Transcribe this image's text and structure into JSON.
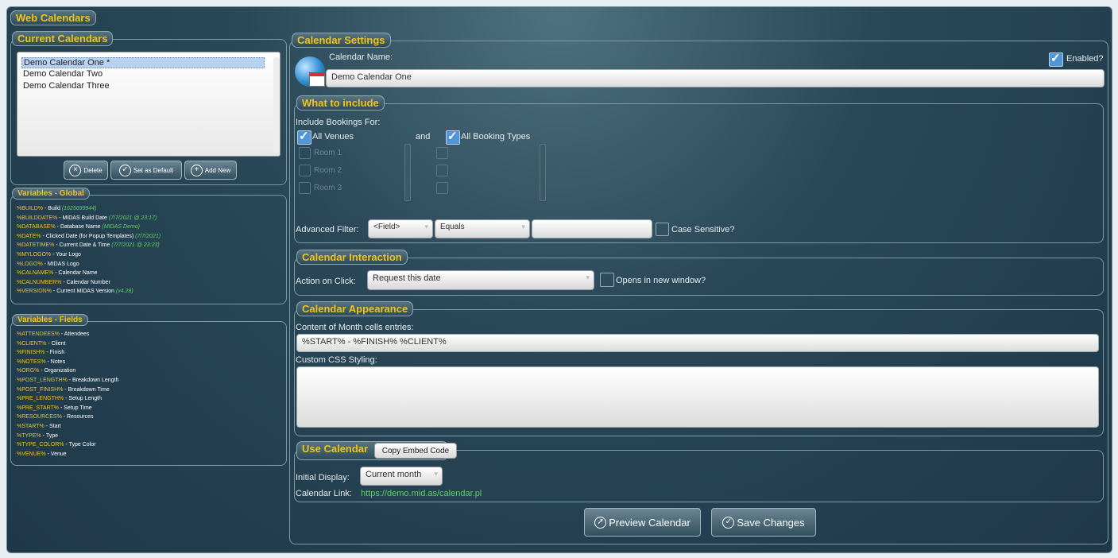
{
  "window_title": "Web Calendars",
  "current_calendars": {
    "title": "Current Calendars",
    "items": [
      "Demo Calendar One *",
      "Demo Calendar Two",
      "Demo Calendar Three"
    ],
    "delete": "Delete",
    "set_default": "Set as Default",
    "add_new": "Add New"
  },
  "vars_global": {
    "title": "Variables - Global",
    "rows": [
      {
        "k": "%BUILD%",
        "d": " - Build ",
        "g": "(1625699944)"
      },
      {
        "k": "%BUILDDATE%",
        "d": " - MIDAS Build Date ",
        "g": "(7/7/2021 @ 23:17)"
      },
      {
        "k": "%DATABASE%",
        "d": " - Database Name ",
        "g": "(MIDAS Demo)"
      },
      {
        "k": "%DATE%",
        "d": " - Clicked Date (for Popup Templates) ",
        "g": "(7/7/2021)"
      },
      {
        "k": "%DATETIME%",
        "d": " - Current Date & Time ",
        "g": "(7/7/2021 @ 23:23)"
      },
      {
        "k": "%MYLOGO%",
        "d": " - Your Logo",
        "g": ""
      },
      {
        "k": "%LOGO%",
        "d": " - MIDAS Logo",
        "g": ""
      },
      {
        "k": "%CALNAME%",
        "d": " - Calendar Name",
        "g": ""
      },
      {
        "k": "%CALNUMBER%",
        "d": " - Calendar Number",
        "g": ""
      },
      {
        "k": "%VERSION%",
        "d": " - Current MIDAS Version ",
        "g": "(v4.28)"
      }
    ]
  },
  "vars_fields": {
    "title": "Variables - Fields",
    "rows": [
      {
        "k": "%ATTENDEES%",
        "d": " - Attendees"
      },
      {
        "k": "%CLIENT%",
        "d": " - Client"
      },
      {
        "k": "%FINISH%",
        "d": " - Finish"
      },
      {
        "k": "%NOTES%",
        "d": " - Notes"
      },
      {
        "k": "%ORG%",
        "d": " - Organization"
      },
      {
        "k": "%POST_LENGTH%",
        "d": " - Breakdown Length"
      },
      {
        "k": "%POST_FINISH%",
        "d": " - Breakdown Time"
      },
      {
        "k": "%PRE_LENGTH%",
        "d": " - Setup Length"
      },
      {
        "k": "%PRE_START%",
        "d": " - Setup Time"
      },
      {
        "k": "%RESOURCES%",
        "d": " - Resources"
      },
      {
        "k": "%START%",
        "d": " - Start"
      },
      {
        "k": "%TYPE%",
        "d": " - Type"
      },
      {
        "k": "%TYPE_COLOR%",
        "d": " - Type Color"
      },
      {
        "k": "%VENUE%",
        "d": " - Venue"
      }
    ]
  },
  "settings": {
    "title": "Calendar Settings",
    "name_label": "Calendar Name:",
    "name_value": "Demo Calendar One",
    "enabled_label": "Enabled?"
  },
  "include": {
    "title": "What to include",
    "label": "Include Bookings For:",
    "all_venues": "All Venues",
    "and": "and",
    "all_types": "All Booking Types",
    "rooms": [
      "Room 1",
      "Room 2",
      "Room 3"
    ],
    "adv_label": "Advanced Filter:",
    "field": "<Field>",
    "op": "Equals",
    "case": "Case Sensitive?"
  },
  "interaction": {
    "title": "Calendar Interaction",
    "label": "Action on Click:",
    "value": "Request this date",
    "new_window": "Opens in new window?"
  },
  "appearance": {
    "title": "Calendar Appearance",
    "content_label": "Content of Month cells entries:",
    "content_value": "%START% - %FINISH% %CLIENT%",
    "css_label": "Custom CSS Styling:"
  },
  "use": {
    "title": "Use Calendar",
    "copy": "Copy Embed Code",
    "initial_label": "Initial Display:",
    "initial_value": "Current month",
    "link_label": "Calendar Link:",
    "link": "https://demo.mid.as/calendar.pl"
  },
  "actions": {
    "preview": "Preview Calendar",
    "save": "Save Changes"
  }
}
